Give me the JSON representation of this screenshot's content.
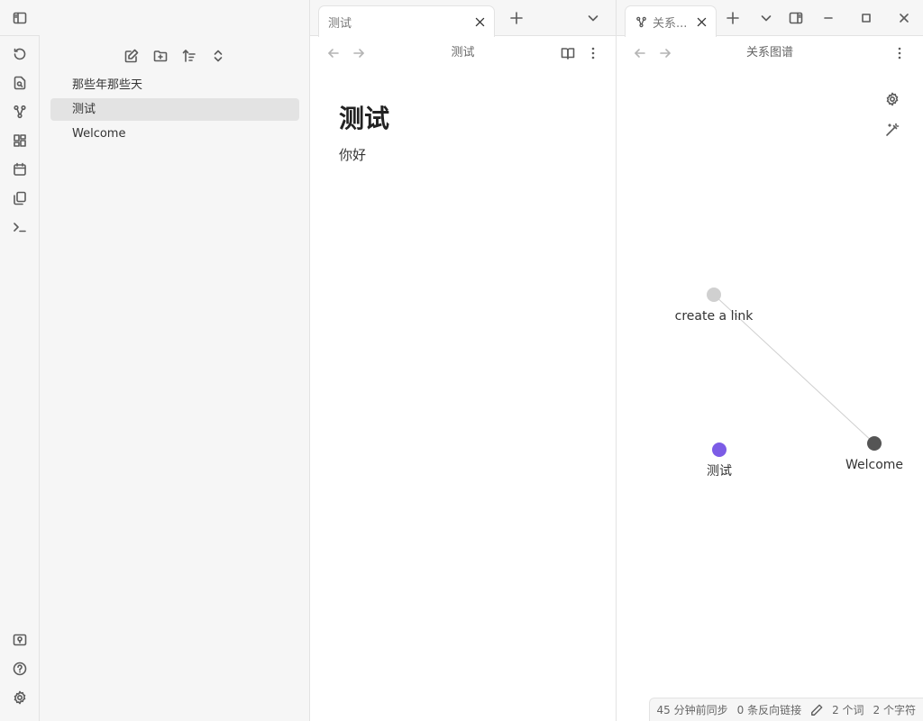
{
  "sidebar": {
    "files": [
      {
        "name": "那些年那些天",
        "active": false
      },
      {
        "name": "测试",
        "active": true
      },
      {
        "name": "Welcome",
        "active": false
      }
    ]
  },
  "left_pane": {
    "tab_label": "测试",
    "view_title": "测试",
    "note_title": "测试",
    "note_body": "你好"
  },
  "right_pane": {
    "tab_label": "关系...",
    "view_title": "关系图谱",
    "graph": {
      "nodes": [
        {
          "id": "create-a-link",
          "label": "create a link",
          "color": "#d0d0d0"
        },
        {
          "id": "welcome",
          "label": "Welcome",
          "color": "#555555"
        },
        {
          "id": "ceshi",
          "label": "测试",
          "color": "#7c5ce6"
        }
      ],
      "edges": [
        [
          "create-a-link",
          "welcome"
        ]
      ]
    }
  },
  "status": {
    "sync": "45 分钟前同步",
    "backlinks": "0 条反向链接",
    "words": "2 个词",
    "chars": "2 个字符"
  },
  "colors": {
    "accent": "#7c5ce6",
    "background": "#ffffff",
    "sidebar": "#f6f6f6"
  }
}
